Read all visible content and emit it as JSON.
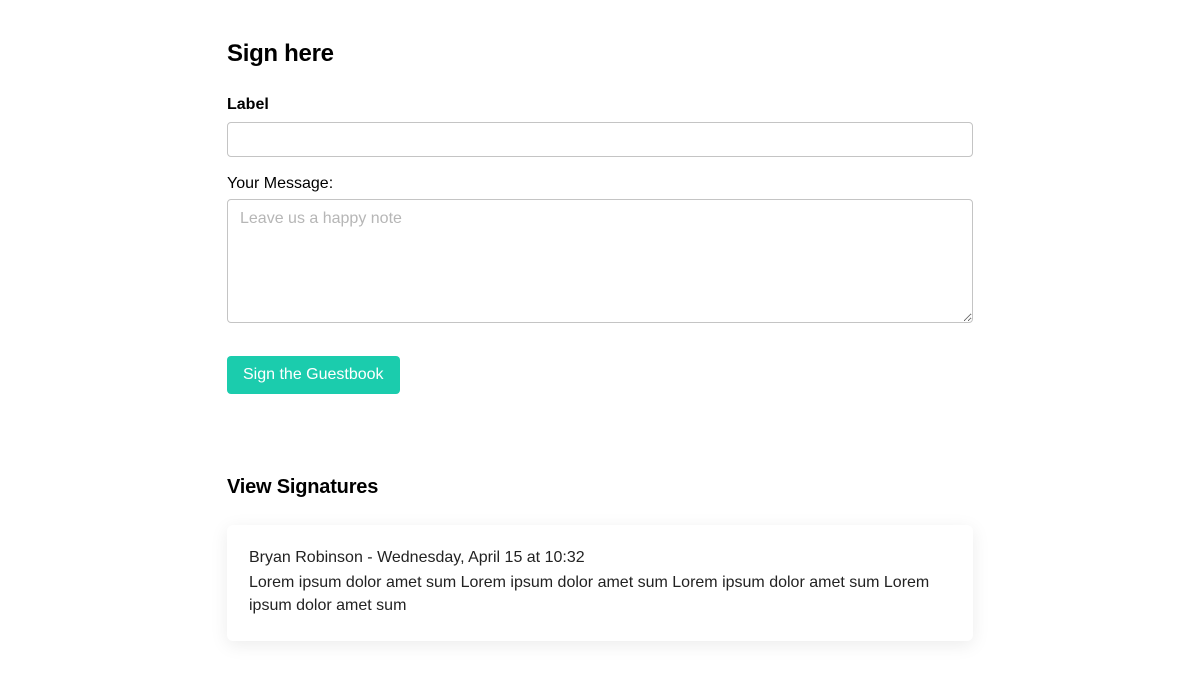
{
  "form": {
    "heading": "Sign here",
    "nameLabel": "Label",
    "nameValue": "",
    "messageLabel": "Your Message:",
    "messagePlaceholder": "Leave us a happy note",
    "messageValue": "",
    "submitLabel": "Sign the Guestbook"
  },
  "signatures": {
    "heading": "View Signatures",
    "entries": [
      {
        "meta": "Bryan Robinson - Wednesday, April 15 at 10:32",
        "body": "Lorem ipsum dolor amet sum Lorem ipsum dolor amet sum Lorem ipsum dolor amet sum Lorem ipsum dolor amet sum"
      }
    ]
  }
}
